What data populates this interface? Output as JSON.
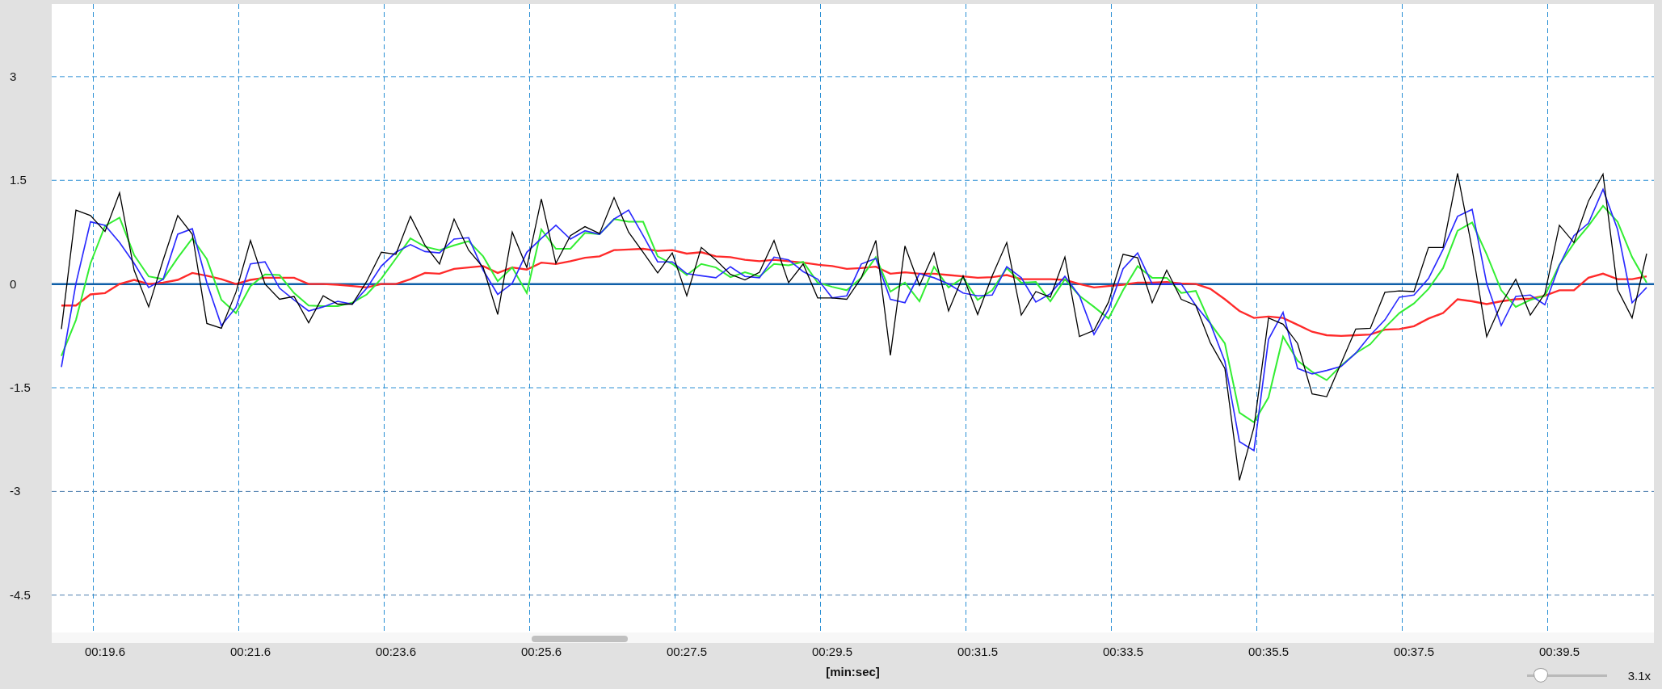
{
  "chart": {
    "chart_data": {
      "type": "line",
      "xlabel": "[min:sec]",
      "categories": [
        null,
        null,
        null,
        "00:19.6",
        null,
        null,
        null,
        null,
        null,
        null,
        null,
        null,
        null,
        "00:21.6",
        null,
        null,
        null,
        null,
        null,
        null,
        null,
        null,
        null,
        "00:23.6",
        null,
        null,
        null,
        null,
        null,
        null,
        null,
        null,
        null,
        "00:25.6",
        null,
        null,
        null,
        null,
        null,
        null,
        null,
        null,
        null,
        "00:27.5",
        null,
        null,
        null,
        null,
        null,
        null,
        null,
        null,
        null,
        "00:29.5",
        null,
        null,
        null,
        null,
        null,
        null,
        null,
        null,
        null,
        "00:31.5",
        null,
        null,
        null,
        null,
        null,
        null,
        null,
        null,
        null,
        "00:33.5",
        null,
        null,
        null,
        null,
        null,
        null,
        null,
        null,
        null,
        "00:35.5",
        null,
        null,
        null,
        null,
        null,
        null,
        null,
        null,
        null,
        "00:37.5",
        null,
        null,
        null,
        null,
        null,
        null,
        null,
        null,
        null,
        "00:39.5",
        null,
        null,
        null,
        null,
        null,
        null
      ],
      "series": [
        {
          "color": "#000000",
          "values": [
            -0.65,
            1.07,
            0.99,
            0.76,
            1.32,
            0.2,
            -0.33,
            0.35,
            0.99,
            0.72,
            -0.57,
            -0.64,
            -0.12,
            0.63,
            0.0,
            -0.22,
            -0.18,
            -0.56,
            -0.17,
            -0.29,
            -0.29,
            0.04,
            0.46,
            0.43,
            0.98,
            0.56,
            0.29,
            0.94,
            0.49,
            0.24,
            -0.44,
            0.75,
            0.24,
            1.23,
            0.3,
            0.7,
            0.83,
            0.73,
            1.25,
            0.75,
            0.46,
            0.16,
            0.45,
            -0.17,
            0.53,
            0.35,
            0.14,
            0.06,
            0.17,
            0.63,
            0.02,
            0.29,
            -0.2,
            -0.2,
            -0.22,
            0.09,
            0.63,
            -1.03,
            0.55,
            -0.02,
            0.45,
            -0.39,
            0.12,
            -0.44,
            0.12,
            0.6,
            -0.45,
            -0.11,
            -0.19,
            0.39,
            -0.76,
            -0.67,
            -0.26,
            0.43,
            0.38,
            -0.27,
            0.2,
            -0.22,
            -0.31,
            -0.85,
            -1.22,
            -2.84,
            -2.07,
            -0.49,
            -0.58,
            -0.86,
            -1.59,
            -1.63,
            -1.14,
            -0.65,
            -0.64,
            -0.12,
            -0.1,
            -0.11,
            0.53,
            0.53,
            1.6,
            0.51,
            -0.76,
            -0.29,
            0.07,
            -0.45,
            -0.14,
            0.85,
            0.6,
            1.2,
            1.59,
            -0.08,
            -0.49,
            0.44
          ]
        },
        {
          "color": "#2a2aff",
          "values": [
            -1.2,
            0.01,
            0.9,
            0.85,
            0.6,
            0.3,
            -0.05,
            0.07,
            0.72,
            0.8,
            0.02,
            -0.6,
            -0.34,
            0.29,
            0.32,
            -0.06,
            -0.23,
            -0.39,
            -0.33,
            -0.25,
            -0.29,
            -0.06,
            0.26,
            0.46,
            0.57,
            0.47,
            0.45,
            0.65,
            0.67,
            0.2,
            -0.15,
            0.01,
            0.46,
            0.66,
            0.85,
            0.65,
            0.77,
            0.72,
            0.94,
            1.07,
            0.7,
            0.32,
            0.32,
            0.15,
            0.12,
            0.09,
            0.25,
            0.11,
            0.09,
            0.39,
            0.35,
            0.18,
            0.07,
            -0.2,
            -0.17,
            0.29,
            0.37,
            -0.22,
            -0.27,
            0.15,
            0.09,
            0.0,
            -0.13,
            -0.17,
            -0.16,
            0.25,
            0.09,
            -0.26,
            -0.14,
            0.11,
            -0.17,
            -0.73,
            -0.37,
            0.22,
            0.45,
            0.0,
            0.0,
            0.0,
            -0.31,
            -0.57,
            -1.12,
            -2.28,
            -2.41,
            -0.8,
            -0.41,
            -1.22,
            -1.3,
            -1.25,
            -1.19,
            -1.0,
            -0.74,
            -0.52,
            -0.19,
            -0.16,
            0.08,
            0.5,
            0.98,
            1.08,
            0.01,
            -0.6,
            -0.18,
            -0.16,
            -0.3,
            0.27,
            0.7,
            0.88,
            1.37,
            0.79,
            -0.27,
            -0.05
          ]
        },
        {
          "color": "#33ee33",
          "values": [
            -1.04,
            -0.52,
            0.3,
            0.84,
            0.96,
            0.42,
            0.11,
            0.07,
            0.38,
            0.66,
            0.36,
            -0.23,
            -0.42,
            -0.03,
            0.14,
            0.13,
            -0.13,
            -0.31,
            -0.32,
            -0.32,
            -0.27,
            -0.15,
            0.08,
            0.37,
            0.66,
            0.54,
            0.49,
            0.56,
            0.62,
            0.4,
            0.04,
            0.24,
            -0.13,
            0.79,
            0.51,
            0.51,
            0.74,
            0.72,
            0.94,
            0.9,
            0.9,
            0.4,
            0.29,
            0.13,
            0.29,
            0.24,
            0.1,
            0.17,
            0.11,
            0.29,
            0.27,
            0.32,
            0.02,
            -0.04,
            -0.09,
            0.09,
            0.39,
            -0.11,
            0.02,
            -0.25,
            0.25,
            -0.05,
            0.09,
            -0.23,
            -0.09,
            0.23,
            0.02,
            0.03,
            -0.25,
            0.07,
            -0.17,
            -0.33,
            -0.5,
            -0.09,
            0.26,
            0.09,
            0.09,
            -0.13,
            -0.1,
            -0.57,
            -0.86,
            -1.86,
            -2.0,
            -1.64,
            -0.76,
            -1.11,
            -1.27,
            -1.39,
            -1.18,
            -1.0,
            -0.87,
            -0.63,
            -0.42,
            -0.28,
            -0.07,
            0.23,
            0.77,
            0.89,
            0.43,
            -0.09,
            -0.33,
            -0.23,
            -0.17,
            0.28,
            0.59,
            0.84,
            1.13,
            0.9,
            0.39,
            0.02
          ]
        },
        {
          "color": "#ff2a2a",
          "values": [
            -0.31,
            -0.31,
            -0.15,
            -0.13,
            0.0,
            0.06,
            0.0,
            0.02,
            0.06,
            0.16,
            0.12,
            0.07,
            0.0,
            0.06,
            0.09,
            0.09,
            0.09,
            0.0,
            0.0,
            -0.01,
            -0.03,
            -0.05,
            0.0,
            0.0,
            0.07,
            0.16,
            0.15,
            0.22,
            0.24,
            0.26,
            0.16,
            0.24,
            0.21,
            0.31,
            0.29,
            0.33,
            0.38,
            0.4,
            0.49,
            0.5,
            0.51,
            0.48,
            0.49,
            0.44,
            0.46,
            0.4,
            0.39,
            0.35,
            0.33,
            0.35,
            0.33,
            0.31,
            0.28,
            0.26,
            0.22,
            0.23,
            0.25,
            0.15,
            0.17,
            0.15,
            0.15,
            0.13,
            0.11,
            0.09,
            0.1,
            0.13,
            0.07,
            0.07,
            0.07,
            0.06,
            0.0,
            -0.05,
            -0.03,
            -0.01,
            0.02,
            0.02,
            0.03,
            0.01,
            0.0,
            -0.07,
            -0.22,
            -0.39,
            -0.49,
            -0.47,
            -0.49,
            -0.59,
            -0.69,
            -0.74,
            -0.75,
            -0.74,
            -0.73,
            -0.66,
            -0.65,
            -0.61,
            -0.5,
            -0.42,
            -0.22,
            -0.25,
            -0.29,
            -0.25,
            -0.22,
            -0.21,
            -0.17,
            -0.09,
            -0.09,
            0.09,
            0.15,
            0.07,
            0.07,
            0.11
          ]
        }
      ],
      "ylim": [
        -5.04,
        4.05
      ],
      "yticks": [
        3,
        1.5,
        0,
        -1.5,
        -3,
        -4.5
      ],
      "grid": true,
      "ref_lines": [
        {
          "axis": "y",
          "value": 0
        }
      ]
    }
  },
  "zoom_slider": {
    "level": 0.18,
    "reading": "3.1x"
  }
}
